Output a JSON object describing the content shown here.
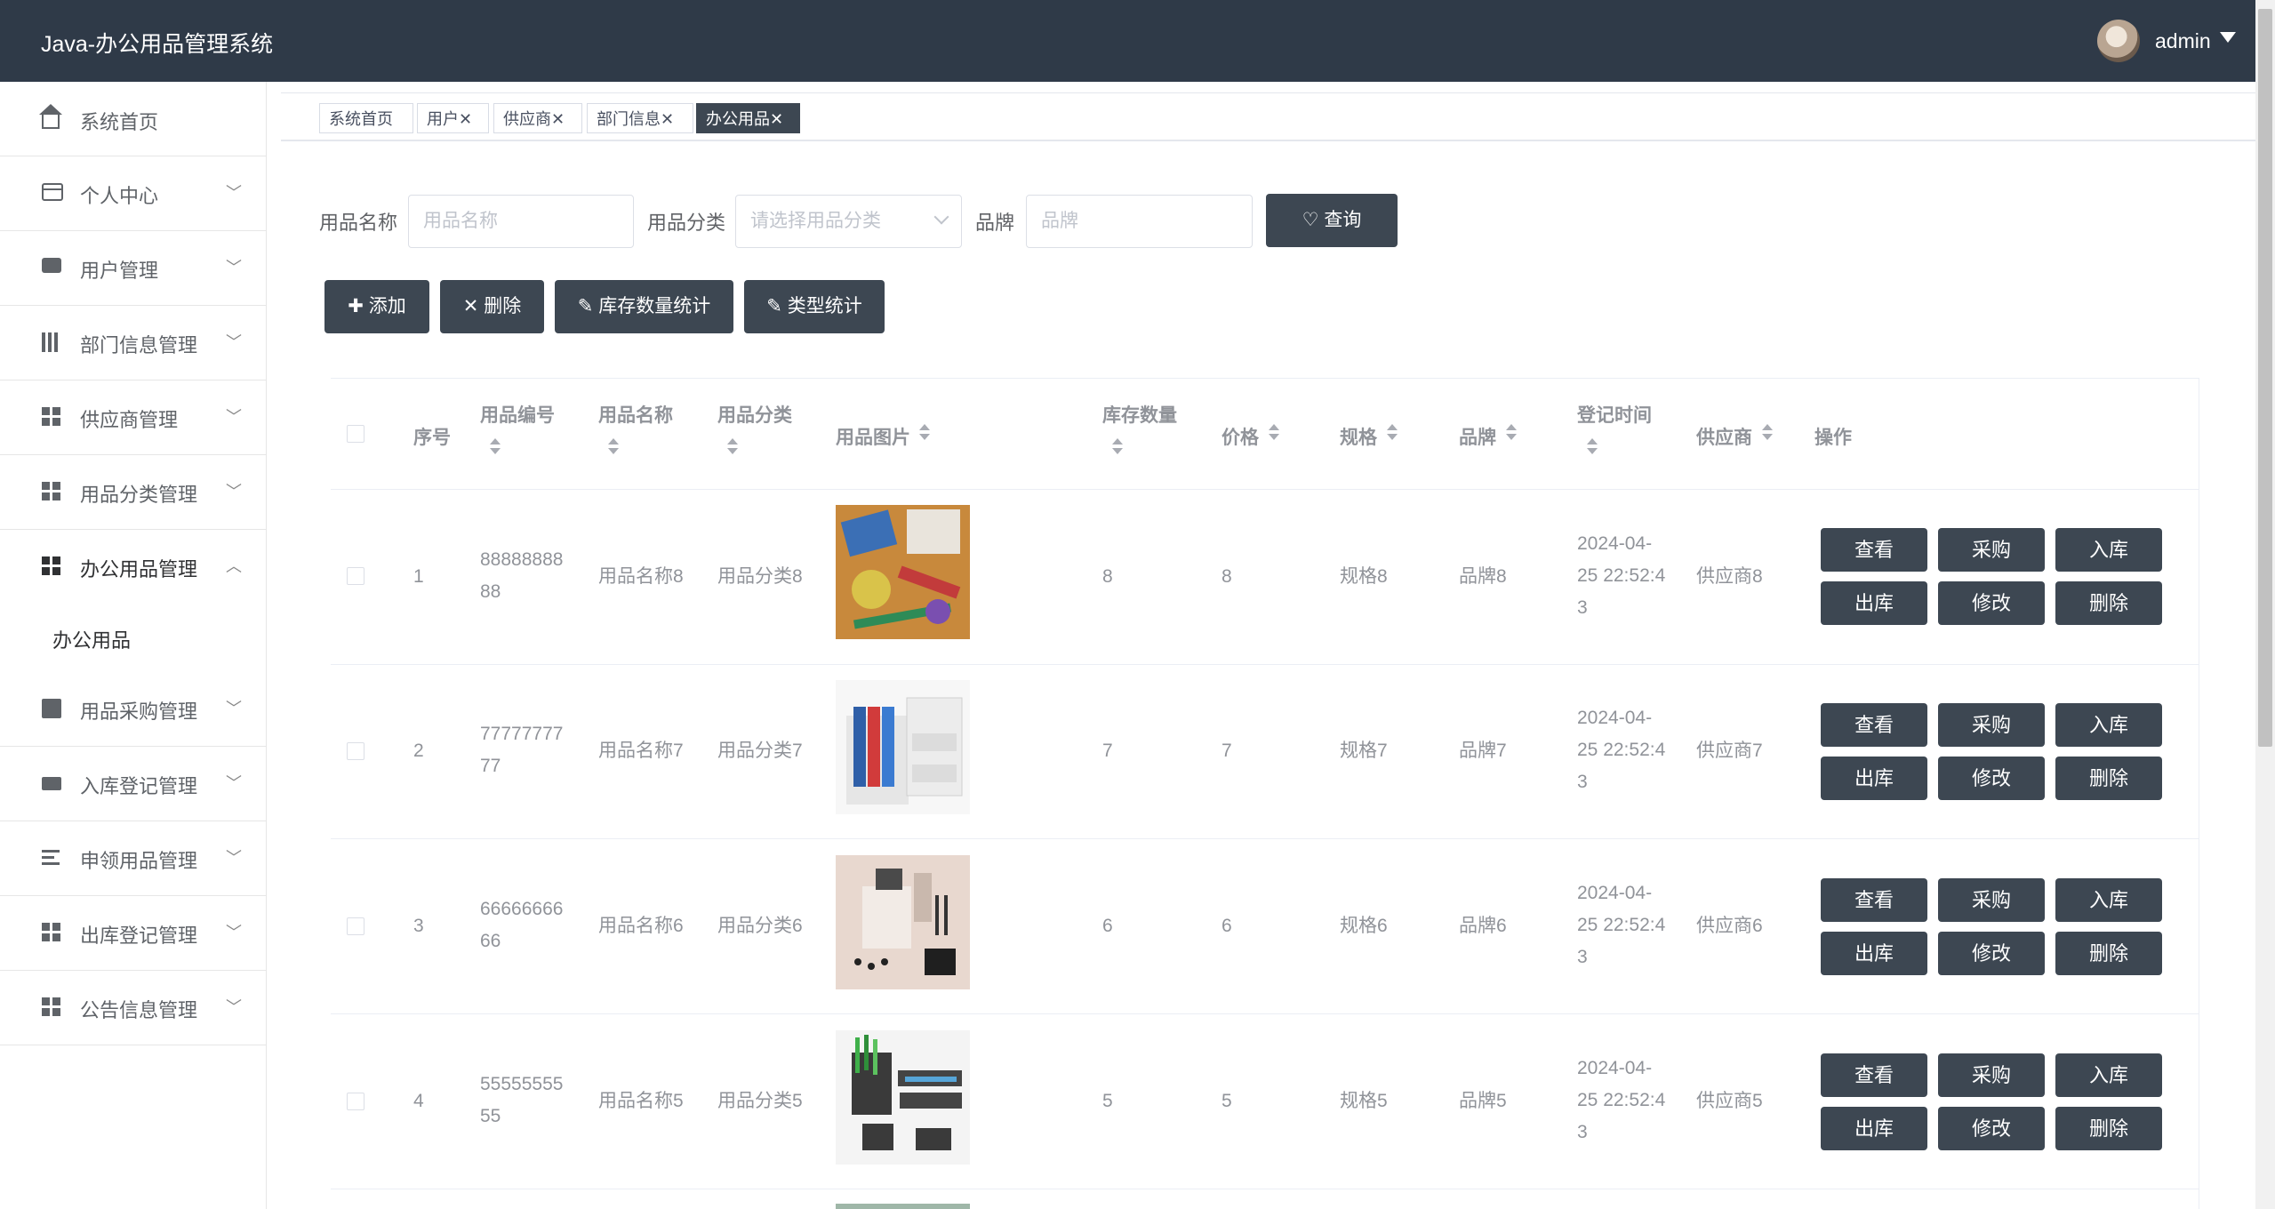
{
  "header": {
    "app_title": "Java-办公用品管理系统",
    "username": "admin"
  },
  "sidebar": {
    "items": [
      {
        "label": "系统首页",
        "icon": "home-icon"
      },
      {
        "label": "个人中心",
        "icon": "card-icon"
      },
      {
        "label": "用户管理",
        "icon": "chat-icon"
      },
      {
        "label": "部门信息管理",
        "icon": "chart-icon"
      },
      {
        "label": "供应商管理",
        "icon": "grid-icon"
      },
      {
        "label": "用品分类管理",
        "icon": "grid-icon"
      },
      {
        "label": "办公用品管理",
        "icon": "grid-icon"
      },
      {
        "label": "用品采购管理",
        "icon": "trend-icon"
      },
      {
        "label": "入库登记管理",
        "icon": "ticket-icon"
      },
      {
        "label": "申领用品管理",
        "icon": "list-icon"
      },
      {
        "label": "出库登记管理",
        "icon": "grid-icon"
      },
      {
        "label": "公告信息管理",
        "icon": "grid-icon"
      }
    ],
    "submenu": {
      "label": "办公用品"
    }
  },
  "tabs": [
    "系统首页",
    "用户",
    "供应商",
    "部门信息",
    "办公用品"
  ],
  "search": {
    "name_label": "用品名称",
    "name_placeholder": "用品名称",
    "category_label": "用品分类",
    "category_placeholder": "请选择用品分类",
    "brand_label": "品牌",
    "brand_placeholder": "品牌",
    "query_button": "查询"
  },
  "toolbar": {
    "add": "添加",
    "delete": "删除",
    "stock_stats": "库存数量统计",
    "type_stats": "类型统计"
  },
  "table": {
    "headers": {
      "index": "序号",
      "code": "用品编号",
      "name": "用品名称",
      "category": "用品分类",
      "image": "用品图片",
      "stock": "库存数量",
      "price": "价格",
      "spec": "规格",
      "brand": "品牌",
      "time": "登记时间",
      "supplier": "供应商",
      "actions": "操作"
    },
    "rows": [
      {
        "index": "1",
        "code_1": "88888888",
        "code_2": "88",
        "name": "用品名称8",
        "category": "用品分类8",
        "stock": "8",
        "price": "8",
        "spec": "规格8",
        "brand": "品牌8",
        "time_1": "2024-04-",
        "time_2": "25 22:52:4",
        "time_3": "3",
        "supplier": "供应商8"
      },
      {
        "index": "2",
        "code_1": "77777777",
        "code_2": "77",
        "name": "用品名称7",
        "category": "用品分类7",
        "stock": "7",
        "price": "7",
        "spec": "规格7",
        "brand": "品牌7",
        "time_1": "2024-04-",
        "time_2": "25 22:52:4",
        "time_3": "3",
        "supplier": "供应商7"
      },
      {
        "index": "3",
        "code_1": "66666666",
        "code_2": "66",
        "name": "用品名称6",
        "category": "用品分类6",
        "stock": "6",
        "price": "6",
        "spec": "规格6",
        "brand": "品牌6",
        "time_1": "2024-04-",
        "time_2": "25 22:52:4",
        "time_3": "3",
        "supplier": "供应商6"
      },
      {
        "index": "4",
        "code_1": "55555555",
        "code_2": "55",
        "name": "用品名称5",
        "category": "用品分类5",
        "stock": "5",
        "price": "5",
        "spec": "规格5",
        "brand": "品牌5",
        "time_1": "2024-04-",
        "time_2": "25 22:52:4",
        "time_3": "3",
        "supplier": "供应商5"
      }
    ],
    "actions": {
      "view": "查看",
      "purchase": "采购",
      "inbound": "入库",
      "outbound": "出库",
      "edit": "修改",
      "delete": "删除"
    }
  },
  "colors": {
    "header_bg": "#2f3a48",
    "button_dark": "#3d4752",
    "active_tab": "#3d4752"
  }
}
